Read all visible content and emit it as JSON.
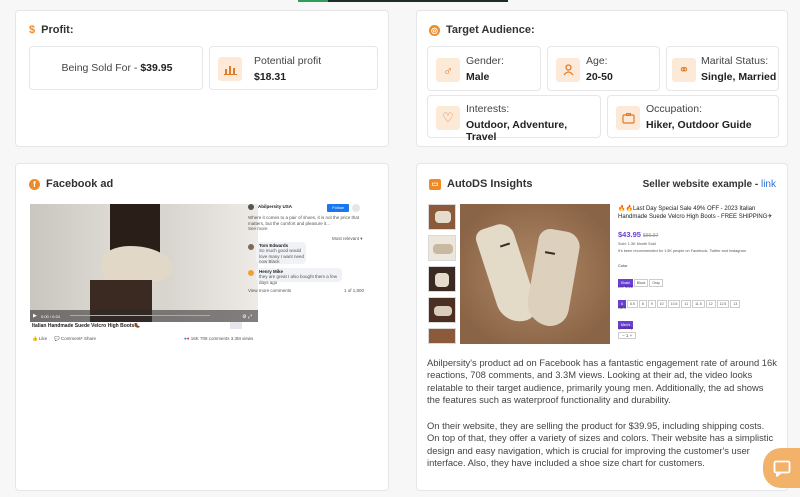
{
  "profit": {
    "title": "Profit:",
    "being_sold_label": "Being Sold For - ",
    "being_sold_value": "$39.95",
    "potential_label": "Potential profit",
    "potential_value": "$18.31"
  },
  "audience": {
    "title": "Target Audience:",
    "gender_label": "Gender:",
    "gender_value": "Male",
    "age_label": "Age:",
    "age_value": "20-50",
    "marital_label": "Marital Status:",
    "marital_value": "Single, Married",
    "interests_label": "Interests:",
    "interests_value": "Outdoor, Adventure, Travel",
    "occupation_label": "Occupation:",
    "occupation_value": "Hiker, Outdoor Guide"
  },
  "facebook": {
    "title": "Facebook ad",
    "ad_caption": "Italian Handmade Suede Velcro High Boots🥾",
    "page_name": "Abilpersity USA",
    "post_text": "Where it comes to a pair of shoes, it is not the price that matters, but the comfort and pleasure it...",
    "see_more": "See more",
    "follow": "Follow",
    "most_relevant": "Most relevant ▾",
    "comment1_name": "Tom Edwards",
    "comment1_text": "So much good would love many I want need now Black",
    "comment2_name": "Henry Mike",
    "comment2_text": "they are great I also bought them a few days ago",
    "view_more": "View more comments",
    "count": "1 of 1,800",
    "like": "Like",
    "comment": "Comment",
    "share": "Share",
    "reactions": "16K",
    "stats": "708 comments  3.3M views",
    "time": "0:00 / 0:24"
  },
  "insights": {
    "title": "AutoDS Insights",
    "seller_label": "Seller website example - ",
    "seller_link": "link",
    "product_title": "🔥🔥Last Day Special Sale 49% OFF - 2023 Italian Handmade Suede Velcro High Boots - FREE SHIPPING✈",
    "price": "$43.95",
    "old_price": "$86.97",
    "sold": "Sold: 1.3K Month Sold",
    "recommended": "It's been recommended for 1.5K people on Facebook, Twitter and Instagram",
    "color_label": "Color",
    "colors": [
      "Khaki",
      "Black",
      "Gray"
    ],
    "size_label": "US SIZE",
    "sizes": [
      "6",
      "6.5",
      "8",
      "9",
      "10",
      "10.5",
      "11",
      "11.5",
      "12",
      "12.5",
      "13"
    ],
    "sex_label": "SEX",
    "sex_value": "Men's",
    "qty_label": "Quantity",
    "qty": "1",
    "paragraph1": "Abilpersity's product ad on Facebook has a fantastic engagement rate of around 16k reactions, 708 comments, and 3.3M views. Looking at their ad, the video looks relatable to their target audience, primarily young men. Additionally, the ad shows the features such as waterproof functionality and durability.",
    "paragraph2": "On their website, they are selling the product for $39.95, including shipping costs. On top of that, they offer a variety of sizes and colors. Their website has a simplistic design and easy navigation, which is crucial for improving the customer's user interface. Also, they have included a shoe size chart for customers."
  }
}
